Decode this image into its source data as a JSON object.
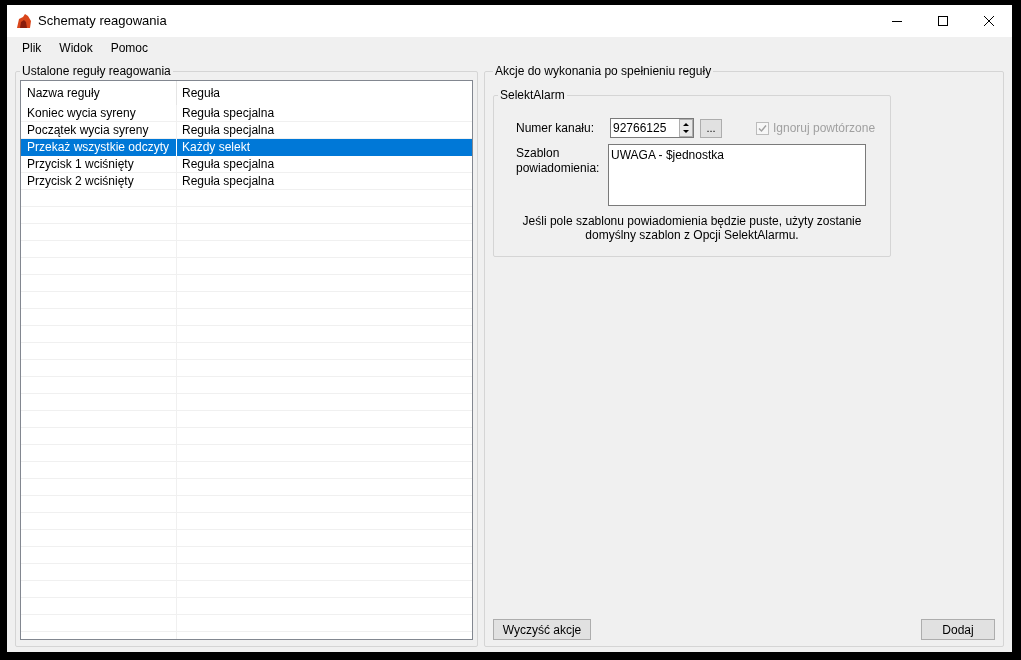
{
  "window": {
    "title": "Schematy reagowania"
  },
  "menu": [
    "Plik",
    "Widok",
    "Pomoc"
  ],
  "rules_group": {
    "title": "Ustalone reguły reagowania",
    "columns": [
      "Nazwa reguły",
      "Reguła"
    ],
    "rows": [
      {
        "name": "Koniec wycia syreny",
        "rule": "Reguła specjalna",
        "selected": false
      },
      {
        "name": "Początek wycia syreny",
        "rule": "Reguła specjalna",
        "selected": false
      },
      {
        "name": "Przekaż wszystkie odczyty",
        "rule": "Każdy selekt",
        "selected": true
      },
      {
        "name": "Przycisk 1 wciśnięty",
        "rule": "Reguła specjalna",
        "selected": false
      },
      {
        "name": "Przycisk 2 wciśnięty",
        "rule": "Reguła specjalna",
        "selected": false
      }
    ]
  },
  "actions_group": {
    "title": "Akcje do wykonania po spełnieniu reguły",
    "selekt_group": {
      "title": "SelektAlarm",
      "channel_label": "Numer kanału:",
      "channel_value": "92766125",
      "browse_button": "...",
      "ignore_repeats": {
        "label": "Ignoruj powtórzone",
        "checked": true,
        "disabled": true
      },
      "template_label": "Szablon powiadomienia:",
      "template_value": "UWAGA - $jednostka",
      "note": "Jeśli pole szablonu powiadomienia będzie puste, użyty zostanie domyślny szablon z Opcji SelektAlarmu."
    },
    "buttons": {
      "clear": "Wyczyść akcje",
      "add": "Dodaj"
    }
  }
}
